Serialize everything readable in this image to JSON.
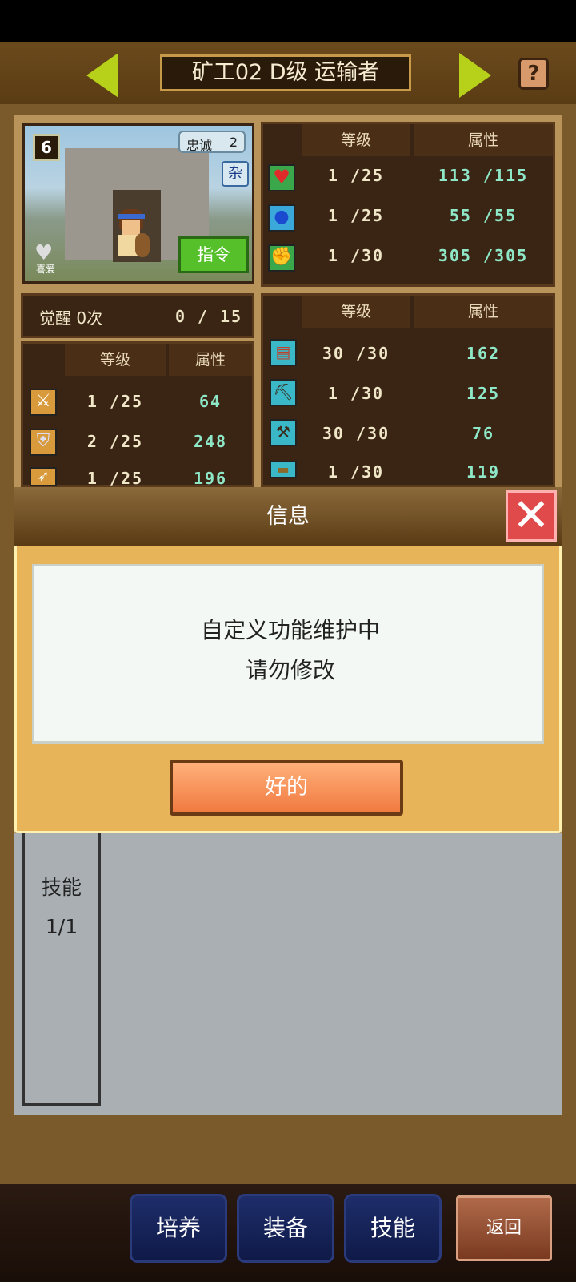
{
  "header": {
    "title": "矿工02 D级 运输者",
    "help_label": "?"
  },
  "portrait": {
    "level_badge": "6",
    "loyalty_label": "忠诚",
    "loyalty_value": "2",
    "miscellaneous_badge": "杂",
    "favorite_label": "喜爱",
    "command_button": "指令"
  },
  "stats_top": {
    "headers": [
      "等级",
      "属性"
    ],
    "rows": [
      {
        "icon": "heart-icon",
        "level": "1 /25",
        "value": "113 /115"
      },
      {
        "icon": "potion-icon",
        "level": "1 /25",
        "value": "55 /55"
      },
      {
        "icon": "arm-strength-icon",
        "level": "1 /30",
        "value": "305 /305"
      }
    ]
  },
  "awaken": {
    "label": "觉醒 0次",
    "progress": "0 /",
    "max": "15"
  },
  "stats_left": {
    "headers": [
      "等级",
      "属性"
    ],
    "rows": [
      {
        "icon": "sword-icon",
        "level": "1 /25",
        "value": "64"
      },
      {
        "icon": "shield-icon",
        "level": "2 /25",
        "value": "248"
      },
      {
        "icon": "arrow-icon",
        "level": "1 /25",
        "value": "196"
      }
    ]
  },
  "stats_right": {
    "headers": [
      "等级",
      "属性"
    ],
    "rows": [
      {
        "icon": "book-icon",
        "level": "30 /30",
        "value": "162"
      },
      {
        "icon": "pickaxe-icon",
        "level": "1 /30",
        "value": "125"
      },
      {
        "icon": "shovel-icon",
        "level": "30 /30",
        "value": "76"
      },
      {
        "icon": "crate-icon",
        "level": "1 /30",
        "value": "119"
      }
    ]
  },
  "dialog": {
    "title": "信息",
    "message_line1": "自定义功能维护中",
    "message_line2": "请勿修改",
    "ok_button": "好的"
  },
  "skills_tab": {
    "label": "技能",
    "count": "1/1"
  },
  "bottom_nav": {
    "train": "培养",
    "equip": "装备",
    "skill": "技能",
    "back": "返回"
  },
  "colors": {
    "accent_green": "#b7d11a",
    "header_brown": "#5a3c14",
    "dialog_gold": "#e8b45a",
    "ok_orange": "#f07a40",
    "close_red": "#e04a4a",
    "nav_blue": "#1e2d6a"
  }
}
